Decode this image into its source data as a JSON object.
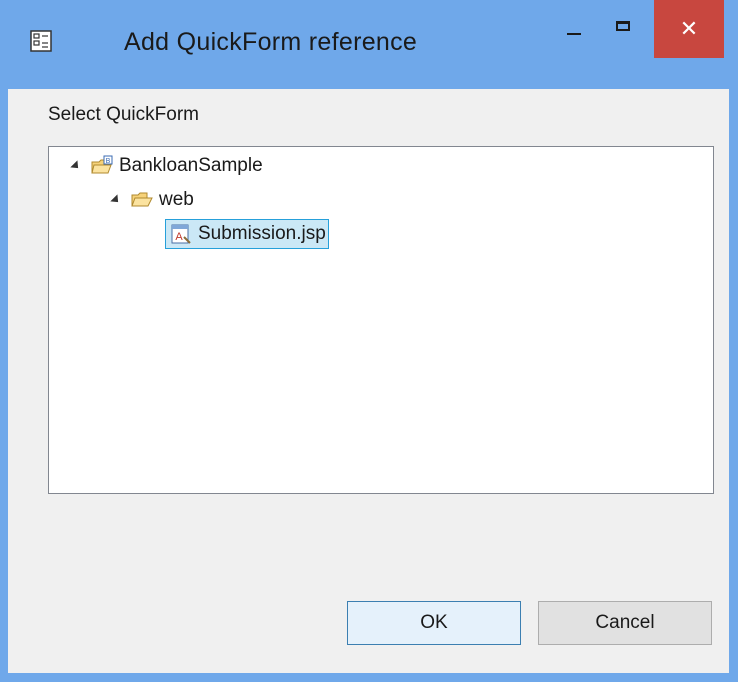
{
  "window": {
    "title": "Add QuickForm reference",
    "close_glyph": "✕"
  },
  "dialog": {
    "section_label": "Select QuickForm"
  },
  "tree": {
    "items": [
      {
        "label": "BankloanSample",
        "icon": "project-icon",
        "expanded": true
      },
      {
        "label": "web",
        "icon": "folder-open-icon",
        "expanded": true
      },
      {
        "label": "Submission.jsp",
        "icon": "jsp-file-icon",
        "selected": true
      }
    ]
  },
  "buttons": {
    "ok_label": "OK",
    "cancel_label": "Cancel"
  },
  "colors": {
    "titlebar": "#6fa8ea",
    "close_button": "#c8473f",
    "selection_fill": "#cbe8f6",
    "selection_border": "#26a0da"
  }
}
